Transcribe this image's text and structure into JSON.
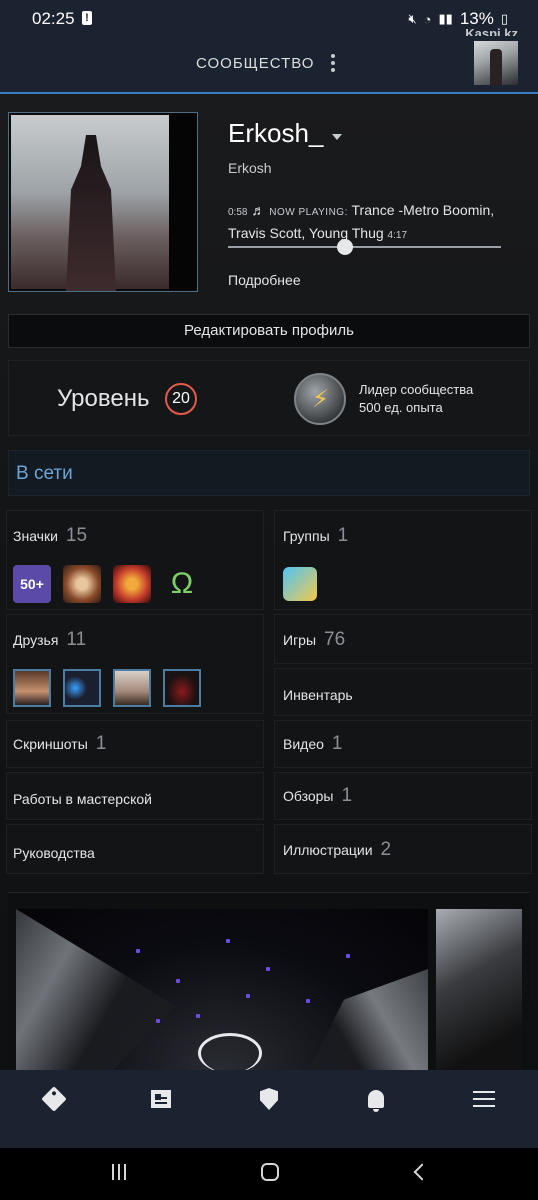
{
  "status_bar": {
    "time": "02:25",
    "battery": "13%",
    "watermark": "Kaspi.kz"
  },
  "header": {
    "title": "СООБЩЕСТВО"
  },
  "profile": {
    "persona_name": "Erkosh_",
    "real_name": "Erkosh",
    "now_playing": {
      "elapsed": "0:58",
      "label": "NOW PLAYING:",
      "track": "Trance -Metro Boomin, Travis Scott, Young Thug",
      "duration": "4:17",
      "progress": 0.43
    },
    "more_link": "Подробнее",
    "edit_button": "Редактировать профиль"
  },
  "level": {
    "label": "Уровень",
    "value": "20",
    "badge_title": "Лидер сообщества",
    "badge_xp": "500 ед. опыта"
  },
  "online_status": "В сети",
  "sections": {
    "badges": {
      "label": "Значки",
      "count": "15",
      "badge_items": [
        "50+"
      ]
    },
    "groups": {
      "label": "Группы",
      "count": "1"
    },
    "friends": {
      "label": "Друзья",
      "count": "11"
    },
    "games": {
      "label": "Игры",
      "count": "76"
    },
    "inventory": {
      "label": "Инвентарь"
    },
    "screenshots": {
      "label": "Скриншоты",
      "count": "1"
    },
    "videos": {
      "label": "Видео",
      "count": "1"
    },
    "workshop": {
      "label": "Работы в мастерской"
    },
    "reviews": {
      "label": "Обзоры",
      "count": "1"
    },
    "guides": {
      "label": "Руководства"
    },
    "artwork": {
      "label": "Иллюстрации",
      "count": "2"
    }
  },
  "colors": {
    "header_bg": "#1b2230",
    "accent_blue": "#3a7ec0",
    "level_ring": "#e35b4b",
    "online_text": "#6aa6d8"
  }
}
